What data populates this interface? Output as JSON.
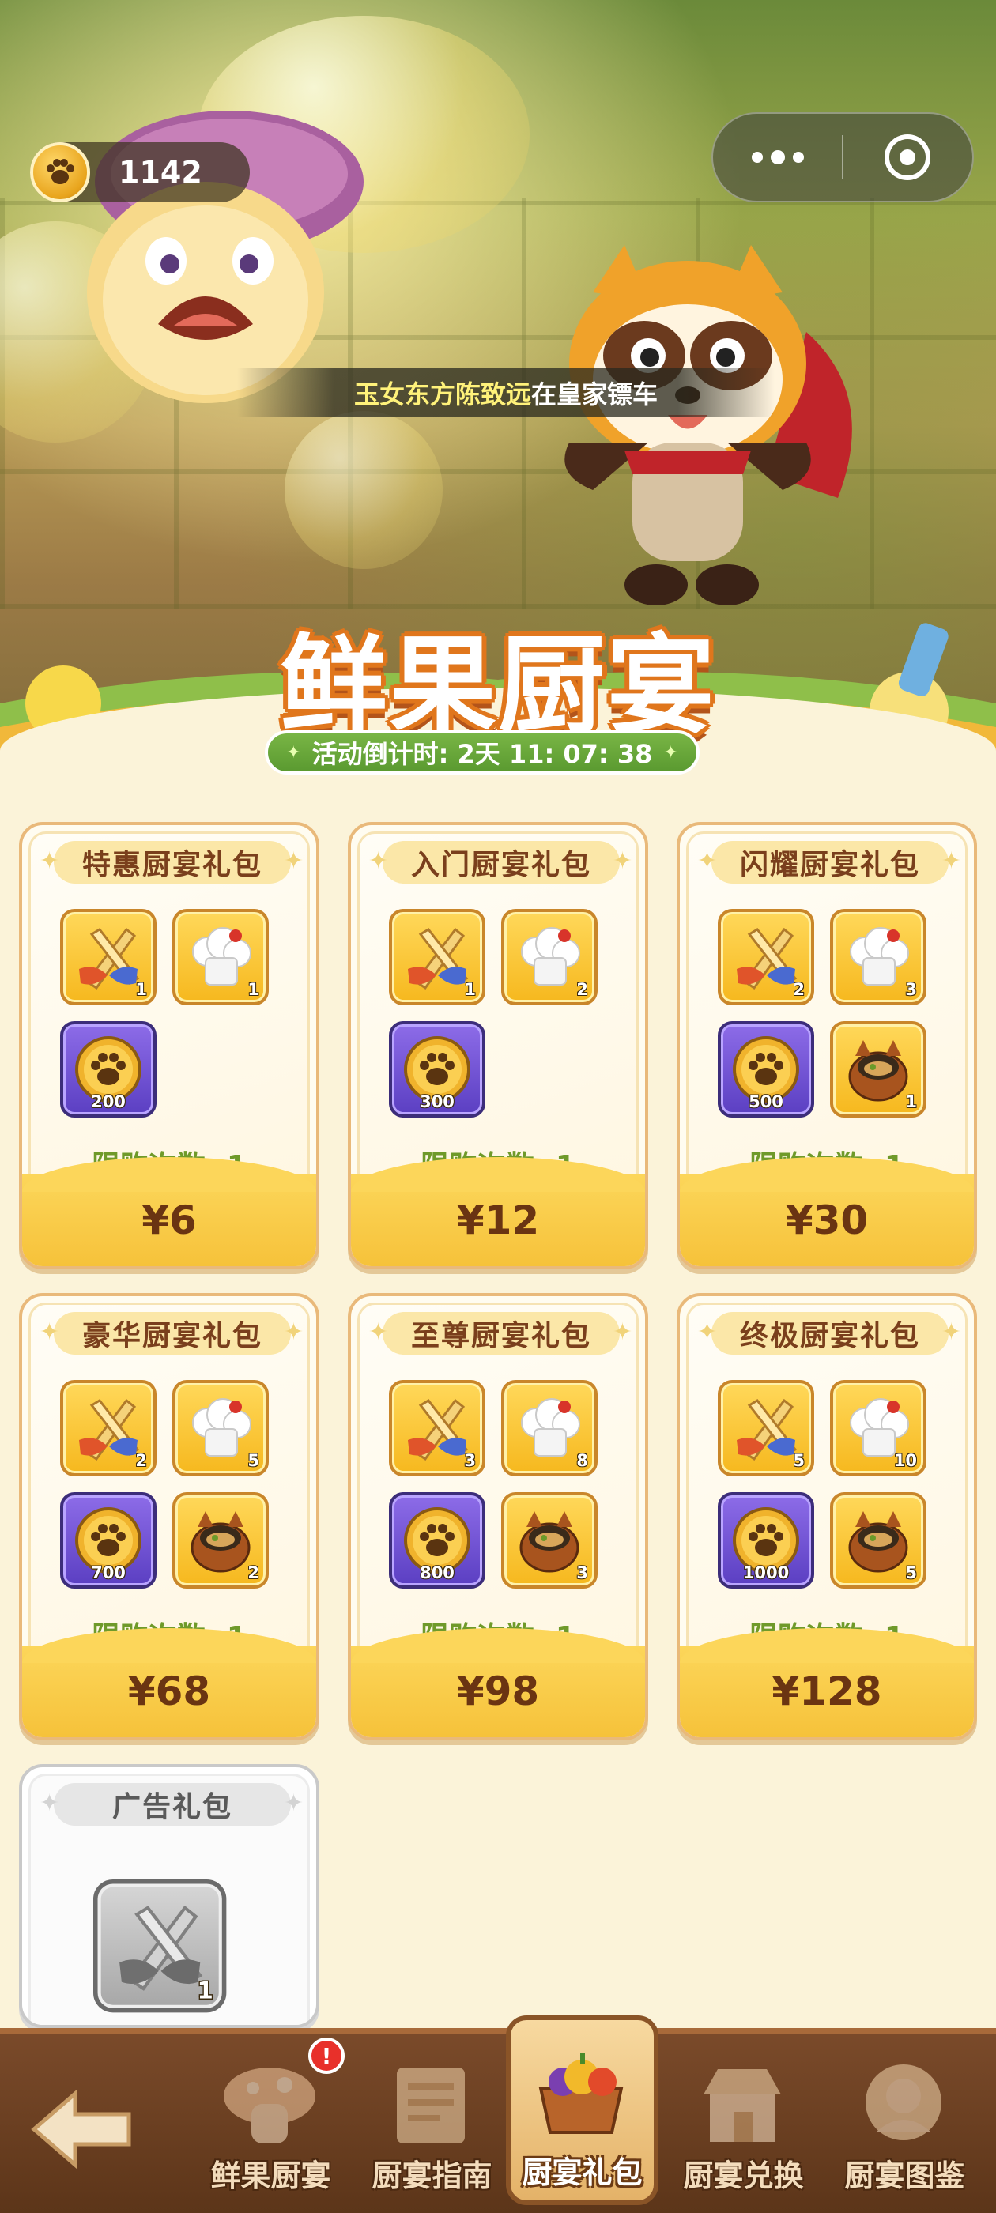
{
  "header": {
    "coins": "1142",
    "marquee_name": "玉女东方陈致远",
    "marquee_text": "在皇家镖车"
  },
  "event": {
    "title": "鲜果厨宴",
    "countdown": "活动倒计时: 2天 11: 07: 38"
  },
  "packs": [
    {
      "title": "特惠厨宴礼包",
      "items": [
        {
          "icon": "knife-fork-icon",
          "tier": "gold",
          "qty": "1"
        },
        {
          "icon": "chef-hat-icon",
          "tier": "gold",
          "qty": "1"
        },
        {
          "icon": "paw-coin-icon",
          "tier": "purple",
          "qty": "200"
        }
      ],
      "limit": "限购次数: 1",
      "price": "¥6"
    },
    {
      "title": "入门厨宴礼包",
      "items": [
        {
          "icon": "knife-fork-icon",
          "tier": "gold",
          "qty": "1"
        },
        {
          "icon": "chef-hat-icon",
          "tier": "gold",
          "qty": "2"
        },
        {
          "icon": "paw-coin-icon",
          "tier": "purple",
          "qty": "300"
        }
      ],
      "limit": "限购次数: 1",
      "price": "¥12"
    },
    {
      "title": "闪耀厨宴礼包",
      "items": [
        {
          "icon": "knife-fork-icon",
          "tier": "gold",
          "qty": "2"
        },
        {
          "icon": "chef-hat-icon",
          "tier": "gold",
          "qty": "3"
        },
        {
          "icon": "paw-coin-icon",
          "tier": "purple",
          "qty": "500"
        },
        {
          "icon": "raccoon-pot-icon",
          "tier": "gold",
          "qty": "1"
        }
      ],
      "limit": "限购次数: 1",
      "price": "¥30"
    },
    {
      "title": "豪华厨宴礼包",
      "items": [
        {
          "icon": "knife-fork-icon",
          "tier": "gold",
          "qty": "2"
        },
        {
          "icon": "chef-hat-icon",
          "tier": "gold",
          "qty": "5"
        },
        {
          "icon": "paw-coin-icon",
          "tier": "purple",
          "qty": "700"
        },
        {
          "icon": "raccoon-pot-icon",
          "tier": "gold",
          "qty": "2"
        }
      ],
      "limit": "限购次数: 1",
      "price": "¥68"
    },
    {
      "title": "至尊厨宴礼包",
      "items": [
        {
          "icon": "knife-fork-icon",
          "tier": "gold",
          "qty": "3"
        },
        {
          "icon": "chef-hat-icon",
          "tier": "gold",
          "qty": "8"
        },
        {
          "icon": "paw-coin-icon",
          "tier": "purple",
          "qty": "800"
        },
        {
          "icon": "raccoon-pot-icon",
          "tier": "gold",
          "qty": "3"
        }
      ],
      "limit": "限购次数: 1",
      "price": "¥98"
    },
    {
      "title": "终极厨宴礼包",
      "items": [
        {
          "icon": "knife-fork-icon",
          "tier": "gold",
          "qty": "5"
        },
        {
          "icon": "chef-hat-icon",
          "tier": "gold",
          "qty": "10"
        },
        {
          "icon": "paw-coin-icon",
          "tier": "purple",
          "qty": "1000"
        },
        {
          "icon": "raccoon-pot-icon",
          "tier": "gold",
          "qty": "5"
        }
      ],
      "limit": "限购次数: 1",
      "price": "¥128"
    }
  ],
  "ad_pack": {
    "title": "广告礼包",
    "items": [
      {
        "icon": "knife-fork-icon",
        "tier": "gray",
        "qty": "1"
      }
    ]
  },
  "nav": {
    "back_icon": "back-arrow-icon",
    "items": [
      {
        "label": "鲜果厨宴",
        "icon": "mushroom-icon",
        "badge": "!"
      },
      {
        "label": "厨宴指南",
        "icon": "scroll-icon"
      },
      {
        "label": "厨宴礼包",
        "icon": "fruit-basket-icon",
        "active": true
      },
      {
        "label": "厨宴兑换",
        "icon": "shop-icon"
      },
      {
        "label": "厨宴图鉴",
        "icon": "portrait-icon"
      }
    ]
  },
  "colors": {
    "price_bar": "#f6c23a",
    "limit_text": "#6f9a2a",
    "card_border": "#e9b97a",
    "purple_slot": "#5b3fc2",
    "gold_slot": "#f6b81e",
    "nav_bg": "#5c3519"
  }
}
